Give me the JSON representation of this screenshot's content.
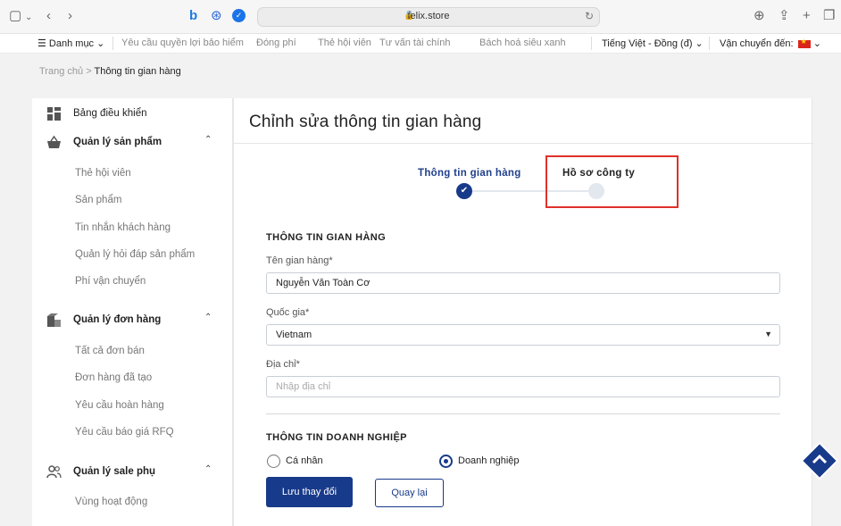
{
  "browser": {
    "url": "felix.store"
  },
  "nav": {
    "menu_label": "Danh mục",
    "links": [
      "Yêu cầu quyền lợi bảo hiểm",
      "Đóng phí",
      "Thẻ hội viên",
      "Tư vấn tài chính",
      "Bách hoá siêu xanh"
    ],
    "language": "Tiếng Việt - Đồng (đ)",
    "shipping": "Vận chuyển đến:"
  },
  "breadcrumb": {
    "home": "Trang chủ",
    "separator": ">",
    "current": "Thông tin gian hàng"
  },
  "sidebar": {
    "dashboard": "Bảng điều khiển",
    "products": {
      "label": "Quản lý sản phẩm",
      "items": [
        "Thẻ hội viên",
        "Sản phẩm",
        "Tin nhắn khách hàng",
        "Quản lý hỏi đáp sản phẩm",
        "Phí vận chuyển"
      ]
    },
    "orders": {
      "label": "Quản lý đơn hàng",
      "items": [
        "Tất cả đơn bán",
        "Đơn hàng đã tạo",
        "Yêu cầu hoàn hàng",
        "Yêu cầu báo giá RFQ"
      ]
    },
    "sales": {
      "label": "Quản lý sale phụ",
      "items": [
        "Vùng hoạt động"
      ]
    }
  },
  "main": {
    "title": "Chỉnh sửa thông tin gian hàng",
    "steps": [
      "Thông tin gian hàng",
      "Hồ sơ công ty"
    ],
    "store_section": "THÔNG TIN GIAN HÀNG",
    "store_name_label": "Tên gian hàng*",
    "store_name_value": "Nguyễn Văn Toàn Cơ",
    "country_label": "Quốc gia*",
    "country_value": "Vietnam",
    "address_label": "Địa chỉ*",
    "address_placeholder": "Nhập địa chỉ",
    "business_section": "THÔNG TIN DOANH NGHIỆP",
    "radio_individual": "Cá nhân",
    "radio_business": "Doanh nghiệp",
    "save_button": "Lưu thay đổi",
    "back_button": "Quay lại"
  },
  "colors": {
    "primary": "#183a8a",
    "highlight": "#e0312b"
  }
}
